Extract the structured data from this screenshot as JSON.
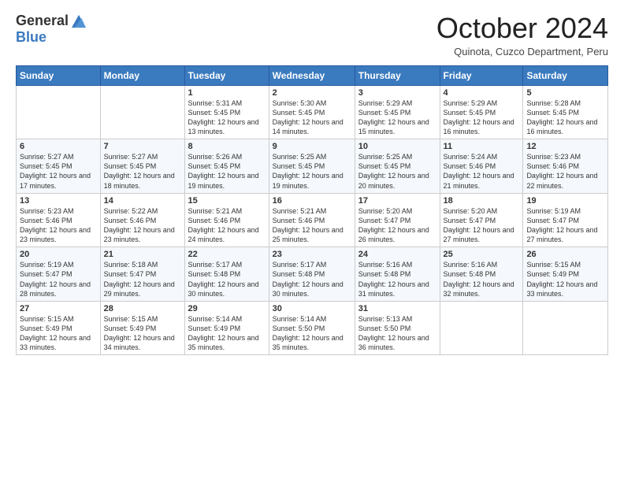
{
  "header": {
    "logo_general": "General",
    "logo_blue": "Blue",
    "month_title": "October 2024",
    "subtitle": "Quinota, Cuzco Department, Peru"
  },
  "weekdays": [
    "Sunday",
    "Monday",
    "Tuesday",
    "Wednesday",
    "Thursday",
    "Friday",
    "Saturday"
  ],
  "weeks": [
    [
      {
        "day": "",
        "sunrise": "",
        "sunset": "",
        "daylight": ""
      },
      {
        "day": "",
        "sunrise": "",
        "sunset": "",
        "daylight": ""
      },
      {
        "day": "1",
        "sunrise": "Sunrise: 5:31 AM",
        "sunset": "Sunset: 5:45 PM",
        "daylight": "Daylight: 12 hours and 13 minutes."
      },
      {
        "day": "2",
        "sunrise": "Sunrise: 5:30 AM",
        "sunset": "Sunset: 5:45 PM",
        "daylight": "Daylight: 12 hours and 14 minutes."
      },
      {
        "day": "3",
        "sunrise": "Sunrise: 5:29 AM",
        "sunset": "Sunset: 5:45 PM",
        "daylight": "Daylight: 12 hours and 15 minutes."
      },
      {
        "day": "4",
        "sunrise": "Sunrise: 5:29 AM",
        "sunset": "Sunset: 5:45 PM",
        "daylight": "Daylight: 12 hours and 16 minutes."
      },
      {
        "day": "5",
        "sunrise": "Sunrise: 5:28 AM",
        "sunset": "Sunset: 5:45 PM",
        "daylight": "Daylight: 12 hours and 16 minutes."
      }
    ],
    [
      {
        "day": "6",
        "sunrise": "Sunrise: 5:27 AM",
        "sunset": "Sunset: 5:45 PM",
        "daylight": "Daylight: 12 hours and 17 minutes."
      },
      {
        "day": "7",
        "sunrise": "Sunrise: 5:27 AM",
        "sunset": "Sunset: 5:45 PM",
        "daylight": "Daylight: 12 hours and 18 minutes."
      },
      {
        "day": "8",
        "sunrise": "Sunrise: 5:26 AM",
        "sunset": "Sunset: 5:45 PM",
        "daylight": "Daylight: 12 hours and 19 minutes."
      },
      {
        "day": "9",
        "sunrise": "Sunrise: 5:25 AM",
        "sunset": "Sunset: 5:45 PM",
        "daylight": "Daylight: 12 hours and 19 minutes."
      },
      {
        "day": "10",
        "sunrise": "Sunrise: 5:25 AM",
        "sunset": "Sunset: 5:45 PM",
        "daylight": "Daylight: 12 hours and 20 minutes."
      },
      {
        "day": "11",
        "sunrise": "Sunrise: 5:24 AM",
        "sunset": "Sunset: 5:46 PM",
        "daylight": "Daylight: 12 hours and 21 minutes."
      },
      {
        "day": "12",
        "sunrise": "Sunrise: 5:23 AM",
        "sunset": "Sunset: 5:46 PM",
        "daylight": "Daylight: 12 hours and 22 minutes."
      }
    ],
    [
      {
        "day": "13",
        "sunrise": "Sunrise: 5:23 AM",
        "sunset": "Sunset: 5:46 PM",
        "daylight": "Daylight: 12 hours and 23 minutes."
      },
      {
        "day": "14",
        "sunrise": "Sunrise: 5:22 AM",
        "sunset": "Sunset: 5:46 PM",
        "daylight": "Daylight: 12 hours and 23 minutes."
      },
      {
        "day": "15",
        "sunrise": "Sunrise: 5:21 AM",
        "sunset": "Sunset: 5:46 PM",
        "daylight": "Daylight: 12 hours and 24 minutes."
      },
      {
        "day": "16",
        "sunrise": "Sunrise: 5:21 AM",
        "sunset": "Sunset: 5:46 PM",
        "daylight": "Daylight: 12 hours and 25 minutes."
      },
      {
        "day": "17",
        "sunrise": "Sunrise: 5:20 AM",
        "sunset": "Sunset: 5:47 PM",
        "daylight": "Daylight: 12 hours and 26 minutes."
      },
      {
        "day": "18",
        "sunrise": "Sunrise: 5:20 AM",
        "sunset": "Sunset: 5:47 PM",
        "daylight": "Daylight: 12 hours and 27 minutes."
      },
      {
        "day": "19",
        "sunrise": "Sunrise: 5:19 AM",
        "sunset": "Sunset: 5:47 PM",
        "daylight": "Daylight: 12 hours and 27 minutes."
      }
    ],
    [
      {
        "day": "20",
        "sunrise": "Sunrise: 5:19 AM",
        "sunset": "Sunset: 5:47 PM",
        "daylight": "Daylight: 12 hours and 28 minutes."
      },
      {
        "day": "21",
        "sunrise": "Sunrise: 5:18 AM",
        "sunset": "Sunset: 5:47 PM",
        "daylight": "Daylight: 12 hours and 29 minutes."
      },
      {
        "day": "22",
        "sunrise": "Sunrise: 5:17 AM",
        "sunset": "Sunset: 5:48 PM",
        "daylight": "Daylight: 12 hours and 30 minutes."
      },
      {
        "day": "23",
        "sunrise": "Sunrise: 5:17 AM",
        "sunset": "Sunset: 5:48 PM",
        "daylight": "Daylight: 12 hours and 30 minutes."
      },
      {
        "day": "24",
        "sunrise": "Sunrise: 5:16 AM",
        "sunset": "Sunset: 5:48 PM",
        "daylight": "Daylight: 12 hours and 31 minutes."
      },
      {
        "day": "25",
        "sunrise": "Sunrise: 5:16 AM",
        "sunset": "Sunset: 5:48 PM",
        "daylight": "Daylight: 12 hours and 32 minutes."
      },
      {
        "day": "26",
        "sunrise": "Sunrise: 5:15 AM",
        "sunset": "Sunset: 5:49 PM",
        "daylight": "Daylight: 12 hours and 33 minutes."
      }
    ],
    [
      {
        "day": "27",
        "sunrise": "Sunrise: 5:15 AM",
        "sunset": "Sunset: 5:49 PM",
        "daylight": "Daylight: 12 hours and 33 minutes."
      },
      {
        "day": "28",
        "sunrise": "Sunrise: 5:15 AM",
        "sunset": "Sunset: 5:49 PM",
        "daylight": "Daylight: 12 hours and 34 minutes."
      },
      {
        "day": "29",
        "sunrise": "Sunrise: 5:14 AM",
        "sunset": "Sunset: 5:49 PM",
        "daylight": "Daylight: 12 hours and 35 minutes."
      },
      {
        "day": "30",
        "sunrise": "Sunrise: 5:14 AM",
        "sunset": "Sunset: 5:50 PM",
        "daylight": "Daylight: 12 hours and 35 minutes."
      },
      {
        "day": "31",
        "sunrise": "Sunrise: 5:13 AM",
        "sunset": "Sunset: 5:50 PM",
        "daylight": "Daylight: 12 hours and 36 minutes."
      },
      {
        "day": "",
        "sunrise": "",
        "sunset": "",
        "daylight": ""
      },
      {
        "day": "",
        "sunrise": "",
        "sunset": "",
        "daylight": ""
      }
    ]
  ]
}
